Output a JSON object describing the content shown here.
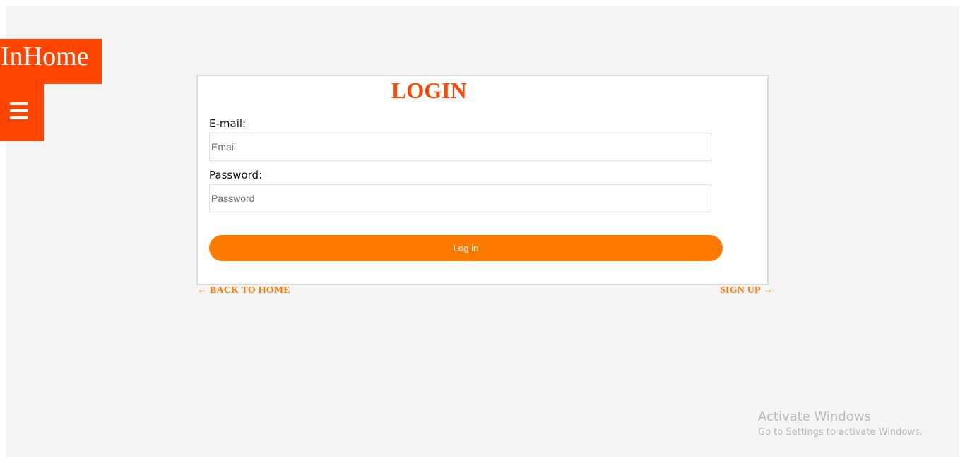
{
  "brand": {
    "name": "InHome",
    "color": "#ff4500"
  },
  "menu": {
    "icon": "hamburger-menu-icon"
  },
  "login": {
    "title": "LOGIN",
    "email": {
      "label": "E-mail:",
      "value": "",
      "placeholder": "Email"
    },
    "password": {
      "label": "Password:",
      "value": "",
      "placeholder": "Password"
    },
    "submit_label": "Log in",
    "accent_color": "#ff7b00"
  },
  "links": {
    "back_home": "← BACK TO HOME",
    "sign_up": "SIGN UP →"
  },
  "watermark": {
    "title": "Activate Windows",
    "subtitle": "Go to Settings to activate Windows."
  }
}
